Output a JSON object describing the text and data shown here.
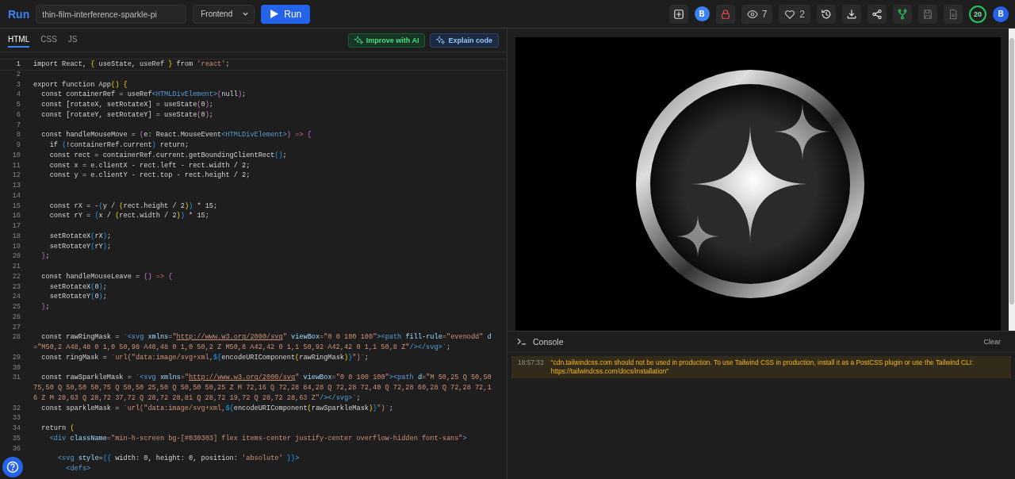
{
  "topbar": {
    "logo": "Run",
    "project_name": "thin-film-interference-sparkle-pi",
    "framework": "Frontend",
    "run_button": "Run",
    "actions": [
      {
        "kind": "icon"
      },
      {
        "kind": "avatar",
        "text": "B"
      },
      {
        "kind": "icon"
      },
      {
        "kind": "count",
        "text": "7"
      },
      {
        "kind": "count",
        "text": "2"
      },
      {
        "kind": "icon"
      },
      {
        "kind": "icon"
      },
      {
        "kind": "icon"
      },
      {
        "kind": "icon"
      },
      {
        "kind": "icon",
        "disabled": true
      },
      {
        "kind": "icon",
        "disabled": true
      },
      {
        "kind": "ring",
        "text": "20"
      },
      {
        "kind": "avatar",
        "text": "B"
      }
    ]
  },
  "editor": {
    "tabs": [
      {
        "label": "HTML",
        "selected": true
      },
      {
        "label": "CSS",
        "selected": false
      },
      {
        "label": "JS",
        "selected": false
      }
    ],
    "buttons": [
      {
        "label": "Improve with AI",
        "kind": "ai"
      },
      {
        "label": "Explain code",
        "kind": "explain"
      }
    ],
    "lines": [
      {
        "number": "1",
        "tokens": [
          "import React, ",
          {
            "kind": "b1",
            "text": "{"
          },
          " useState, useRef ",
          {
            "kind": "b1",
            "text": "}"
          },
          " from ",
          {
            "kind": "str",
            "text": "'react'"
          },
          ";"
        ]
      },
      {
        "number": "2"
      },
      {
        "number": "3",
        "tokens": [
          "export function App",
          {
            "kind": "b1",
            "text": "() {"
          }
        ]
      },
      {
        "number": "4",
        "tokens": [
          "  const containerRef = useRef",
          {
            "kind": "tag",
            "text": "<HTMLDivElement>"
          },
          {
            "kind": "b2",
            "text": "("
          },
          "null",
          {
            "kind": "b2",
            "text": ")"
          },
          ";"
        ]
      },
      {
        "number": "5",
        "tokens": [
          "  const [rotateX, setRotateX] = useState",
          {
            "kind": "b2",
            "text": "("
          },
          "0",
          {
            "kind": "b2",
            "text": ")"
          },
          ";"
        ]
      },
      {
        "number": "6",
        "tokens": [
          "  const [rotateY, setRotateY] = useState",
          {
            "kind": "b2",
            "text": "("
          },
          "0",
          {
            "kind": "b2",
            "text": ")"
          },
          ";"
        ]
      },
      {
        "number": "7"
      },
      {
        "number": "8",
        "tokens": [
          "  const handleMouseMove = ",
          {
            "kind": "b2",
            "text": "("
          },
          "e: React.MouseEvent",
          {
            "kind": "tag",
            "text": "<HTMLDivElement>"
          },
          {
            "kind": "b2",
            "text": ")"
          },
          {
            "kind": "op",
            "text": " => "
          },
          {
            "kind": "b2",
            "text": "{"
          }
        ]
      },
      {
        "number": "9",
        "tokens": [
          "    if ",
          {
            "kind": "b3",
            "text": "("
          },
          "!containerRef.current",
          {
            "kind": "b3",
            "text": ")"
          },
          " return;"
        ]
      },
      {
        "number": "10",
        "tokens": [
          "    const rect = containerRef.current.getBoundingClientRect",
          {
            "kind": "b3",
            "text": "()"
          },
          ";"
        ]
      },
      {
        "number": "11",
        "tokens": [
          "    const x = e.clientX - rect.left - rect.width / 2;"
        ]
      },
      {
        "number": "12",
        "tokens": [
          "    const y = e.clientY - rect.top - rect.height / 2;"
        ]
      },
      {
        "number": "13"
      },
      {
        "number": "14"
      },
      {
        "number": "15",
        "tokens": [
          "    const rX = -",
          {
            "kind": "b3",
            "text": "("
          },
          "y / ",
          {
            "kind": "b1",
            "text": "("
          },
          "rect.height / 2",
          {
            "kind": "b1",
            "text": ")"
          },
          {
            "kind": "b3",
            "text": ")"
          },
          " * 15;"
        ]
      },
      {
        "number": "16",
        "tokens": [
          "    const rY = ",
          {
            "kind": "b3",
            "text": "("
          },
          "x / ",
          {
            "kind": "b1",
            "text": "("
          },
          "rect.width / 2",
          {
            "kind": "b1",
            "text": ")"
          },
          {
            "kind": "b3",
            "text": ")"
          },
          " * 15;"
        ]
      },
      {
        "number": "17"
      },
      {
        "number": "18",
        "tokens": [
          "    setRotateX",
          {
            "kind": "b3",
            "text": "("
          },
          "rX",
          {
            "kind": "b3",
            "text": ")"
          },
          ";"
        ]
      },
      {
        "number": "19",
        "tokens": [
          "    setRotateY",
          {
            "kind": "b3",
            "text": "("
          },
          "rY",
          {
            "kind": "b3",
            "text": ")"
          },
          ";"
        ]
      },
      {
        "number": "20",
        "tokens": [
          {
            "kind": "b2",
            "text": "  }"
          },
          ";"
        ]
      },
      {
        "number": "21"
      },
      {
        "number": "22",
        "tokens": [
          "  const handleMouseLeave = ",
          {
            "kind": "b2",
            "text": "()"
          },
          {
            "kind": "op",
            "text": " => "
          },
          {
            "kind": "b2",
            "text": "{"
          }
        ]
      },
      {
        "number": "23",
        "tokens": [
          "    setRotateX",
          {
            "kind": "b3",
            "text": "("
          },
          "0",
          {
            "kind": "b3",
            "text": ")"
          },
          ";"
        ]
      },
      {
        "number": "24",
        "tokens": [
          "    setRotateY",
          {
            "kind": "b3",
            "text": "("
          },
          "0",
          {
            "kind": "b3",
            "text": ")"
          },
          ";"
        ]
      },
      {
        "number": "25",
        "tokens": [
          {
            "kind": "b2",
            "text": "  }"
          },
          ";"
        ]
      },
      {
        "number": "26"
      },
      {
        "number": "27"
      },
      {
        "number": "28",
        "tokens": [
          "  const rawRingMask = ",
          {
            "kind": "str",
            "text": "`"
          },
          {
            "kind": "tag",
            "text": "<svg"
          },
          {
            "kind": "attr",
            "text": " xmlns"
          },
          {
            "kind": "str",
            "text": "=\""
          },
          {
            "kind": "url",
            "text": "http://www.w3.org/2000/svg"
          },
          {
            "kind": "str",
            "text": "\""
          },
          {
            "kind": "attr",
            "text": " viewBox"
          },
          {
            "kind": "str",
            "text": "=\"0 0 100 100\""
          },
          {
            "kind": "tag",
            "text": "><path"
          },
          {
            "kind": "attr",
            "text": " fill-rule"
          },
          {
            "kind": "str",
            "text": "=\"evenodd\""
          },
          {
            "kind": "attr",
            "text": " d"
          },
          {
            "kind": "str",
            "text": "=\"M50,2 A48,48 0 1,0 50,98 A48,48 0 1,0 50,2 Z M50,8 A42,42 0 1,1 50,92 A42,42 0 1,1 50,8 Z\""
          },
          {
            "kind": "tag",
            "text": "/></svg>"
          },
          {
            "kind": "str",
            "text": "`"
          },
          ";"
        ]
      },
      {
        "number": "29",
        "tokens": [
          "  const ringMask = ",
          {
            "kind": "str",
            "text": "`url(\"data:image/svg+xml,"
          },
          {
            "kind": "b3",
            "text": "${"
          },
          "encodeURIComponent",
          {
            "kind": "b1",
            "text": "("
          },
          "rawRingMask",
          {
            "kind": "b1",
            "text": ")"
          },
          {
            "kind": "b3",
            "text": "}"
          },
          {
            "kind": "str",
            "text": "\")`"
          },
          ";"
        ]
      },
      {
        "number": "30"
      },
      {
        "number": "31",
        "tokens": [
          "  const rawSparkleMask = ",
          {
            "kind": "str",
            "text": "`"
          },
          {
            "kind": "tag",
            "text": "<svg"
          },
          {
            "kind": "attr",
            "text": " xmlns"
          },
          {
            "kind": "str",
            "text": "=\""
          },
          {
            "kind": "url",
            "text": "http://www.w3.org/2000/svg"
          },
          {
            "kind": "str",
            "text": "\""
          },
          {
            "kind": "attr",
            "text": " viewBox"
          },
          {
            "kind": "str",
            "text": "=\"0 0 100 100\""
          },
          {
            "kind": "tag",
            "text": "><path"
          },
          {
            "kind": "attr",
            "text": " d"
          },
          {
            "kind": "str",
            "text": "=\"M 50,25 Q 50,50 75,50 Q 50,50 50,75 Q 50,50 25,50 Q 50,50 50,25 Z M 72,16 Q 72,28 84,28 Q 72,28 72,40 Q 72,28 60,28 Q 72,28 72,16 Z M 28,63 Q 28,72 37,72 Q 28,72 28,81 Q 28,72 19,72 Q 28,72 28,63 Z\""
          },
          {
            "kind": "tag",
            "text": "/></svg>"
          },
          {
            "kind": "str",
            "text": "`"
          },
          ";"
        ]
      },
      {
        "number": "32",
        "tokens": [
          "  const sparkleMask = ",
          {
            "kind": "str",
            "text": "`url(\"data:image/svg+xml,"
          },
          {
            "kind": "b3",
            "text": "${"
          },
          "encodeURIComponent",
          {
            "kind": "b1",
            "text": "("
          },
          "rawSparkleMask",
          {
            "kind": "b1",
            "text": ")"
          },
          {
            "kind": "b3",
            "text": "}"
          },
          {
            "kind": "str",
            "text": "\")`"
          },
          ";"
        ]
      },
      {
        "number": "33"
      },
      {
        "number": "34",
        "tokens": [
          "  return ",
          {
            "kind": "b1",
            "text": "("
          }
        ]
      },
      {
        "number": "35",
        "tokens": [
          {
            "kind": "tag",
            "text": "    <div"
          },
          {
            "kind": "attr",
            "text": " className"
          },
          {
            "kind": "str",
            "text": "=\"min-h-screen bg-[#030303] flex items-center justify-center overflow-hidden font-sans\""
          },
          {
            "kind": "tag",
            "text": ">"
          }
        ]
      },
      {
        "number": "36"
      },
      {
        "tokens": [
          {
            "kind": "tag",
            "text": "      <svg"
          },
          {
            "kind": "attr",
            "text": " style"
          },
          "=",
          {
            "kind": "b3",
            "text": "{{"
          },
          " width: 0, height: 0, position: ",
          {
            "kind": "str",
            "text": "'absolute'"
          },
          {
            "kind": "b3",
            "text": " }}"
          },
          {
            "kind": "tag",
            "text": ">"
          }
        ]
      },
      {
        "tokens": [
          {
            "kind": "tag",
            "text": "        <defs>"
          }
        ]
      }
    ]
  },
  "console": {
    "title": "Console",
    "clear": "Clear",
    "messages": [
      {
        "kind": "warning",
        "time": "18:57:33",
        "text": "\"cdn.tailwindcss.com should not be used in production. To use Tailwind CSS in production, install it as a PostCSS plugin or use the Tailwind CLI: https://tailwindcss.com/docs/installation\""
      }
    ]
  }
}
